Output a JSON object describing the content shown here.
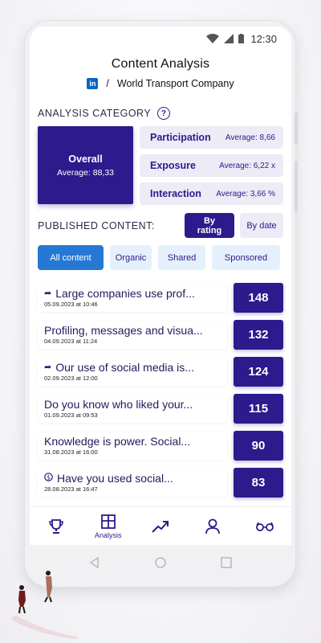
{
  "statusbar": {
    "time": "12:30"
  },
  "header": {
    "title": "Content Analysis",
    "separator": "/",
    "company": "World Transport Company",
    "linkedin_icon_text": "in"
  },
  "analysis": {
    "section_label": "ANALYSIS CATEGORY",
    "help_icon_text": "?",
    "overall": {
      "name": "Overall",
      "average": "Average: 88,33"
    },
    "metrics": [
      {
        "name": "Participation",
        "average": "Average: 8,66"
      },
      {
        "name": "Exposure",
        "average": "Average: 6,22 x"
      },
      {
        "name": "Interaction",
        "average": "Average: 3,66 %"
      }
    ]
  },
  "published": {
    "section_label": "PUBLISHED CONTENT:",
    "sort_by_rating": "By rating",
    "sort_by_date": "By date",
    "filters": [
      "All content",
      "Organic",
      "Shared",
      "Sponsored"
    ]
  },
  "posts": [
    {
      "icon": "share-icon",
      "title": "Large companies use prof...",
      "date": "05.09.2023 at 10:46",
      "score": "148"
    },
    {
      "icon": "",
      "title": "Profiling, messages and visua...",
      "date": "04.09.2023 at 11:24",
      "score": "132"
    },
    {
      "icon": "share-icon",
      "title": "Our use of social media is...",
      "date": "02.09.2023 at 12:00",
      "score": "124"
    },
    {
      "icon": "",
      "title": "Do you know who liked your...",
      "date": "01.09.2023 at 09:53",
      "score": "115"
    },
    {
      "icon": "",
      "title": "Knowledge is power. Social...",
      "date": "31.08.2023 at 16:00",
      "score": "90"
    },
    {
      "icon": "sponsored-icon",
      "title": "Have you used social...",
      "date": "28.08.2023 at 16:47",
      "score": "83"
    }
  ],
  "nav": {
    "analysis_label": "Analysis"
  },
  "colors": {
    "primary": "#2d1a8c",
    "accent_blue": "#2578d4",
    "metric_bg": "#ecebf6",
    "filter_bg": "#e4f0fb"
  }
}
